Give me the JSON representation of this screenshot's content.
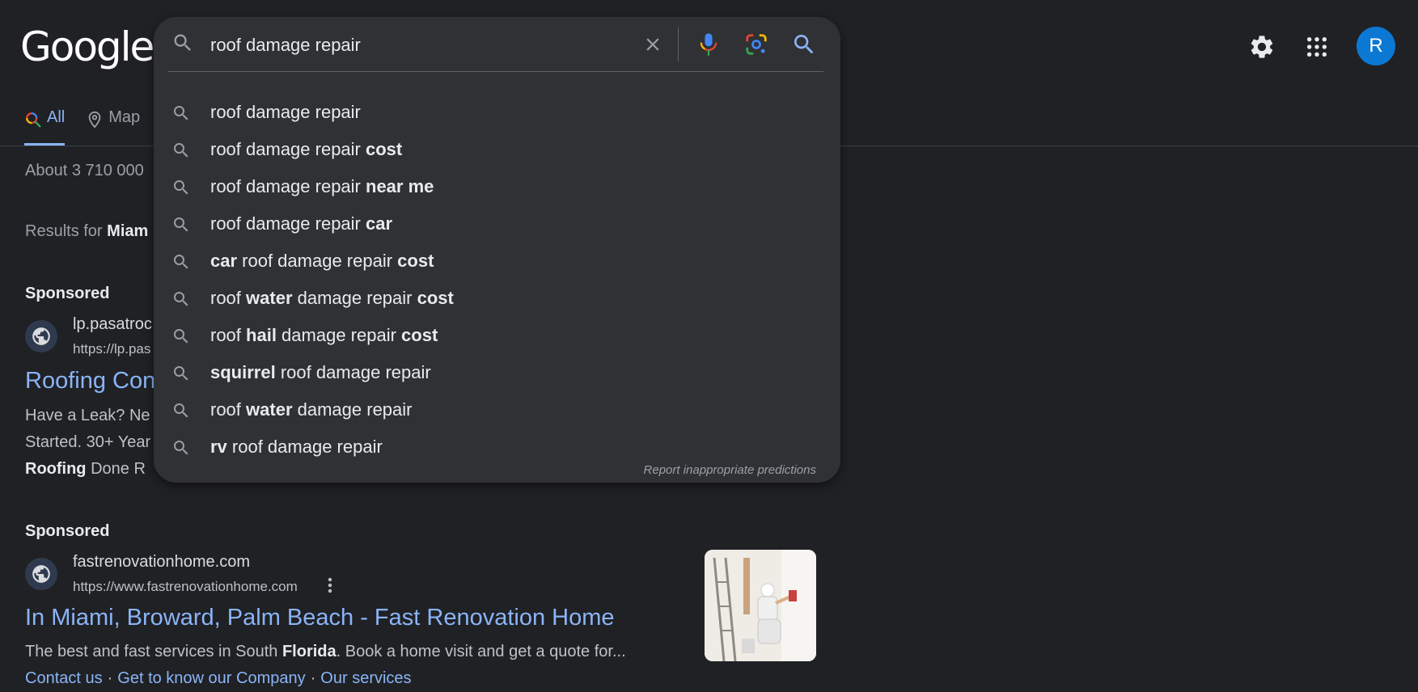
{
  "header": {
    "logo_text": "Google",
    "avatar_letter": "R"
  },
  "search": {
    "query": "roof damage repair",
    "report_label": "Report inappropriate predictions",
    "suggestions": [
      {
        "segments": [
          {
            "t": "roof damage repair",
            "b": false
          }
        ]
      },
      {
        "segments": [
          {
            "t": "roof damage repair ",
            "b": false
          },
          {
            "t": "cost",
            "b": true
          }
        ]
      },
      {
        "segments": [
          {
            "t": "roof damage repair ",
            "b": false
          },
          {
            "t": "near me",
            "b": true
          }
        ]
      },
      {
        "segments": [
          {
            "t": "roof damage repair ",
            "b": false
          },
          {
            "t": "car",
            "b": true
          }
        ]
      },
      {
        "segments": [
          {
            "t": "car",
            "b": true
          },
          {
            "t": " roof damage repair ",
            "b": false
          },
          {
            "t": "cost",
            "b": true
          }
        ]
      },
      {
        "segments": [
          {
            "t": "roof ",
            "b": false
          },
          {
            "t": "water",
            "b": true
          },
          {
            "t": " damage repair ",
            "b": false
          },
          {
            "t": "cost",
            "b": true
          }
        ]
      },
      {
        "segments": [
          {
            "t": "roof ",
            "b": false
          },
          {
            "t": "hail",
            "b": true
          },
          {
            "t": " damage repair ",
            "b": false
          },
          {
            "t": "cost",
            "b": true
          }
        ]
      },
      {
        "segments": [
          {
            "t": "squirrel",
            "b": true
          },
          {
            "t": " roof damage repair",
            "b": false
          }
        ]
      },
      {
        "segments": [
          {
            "t": "roof ",
            "b": false
          },
          {
            "t": "water",
            "b": true
          },
          {
            "t": " damage repair",
            "b": false
          }
        ]
      },
      {
        "segments": [
          {
            "t": "rv",
            "b": true
          },
          {
            "t": " roof damage repair",
            "b": false
          }
        ]
      }
    ]
  },
  "tabs": [
    {
      "label": "All",
      "active": true
    },
    {
      "label": "Map",
      "active": false
    }
  ],
  "result_stats": "About 3 710 000",
  "results_for": {
    "prefix": "Results for ",
    "location": "Miam"
  },
  "ads": [
    {
      "sponsored_label": "Sponsored",
      "site_name": "lp.pasatroc",
      "site_url": "https://lp.pas",
      "title": "Roofing Con",
      "desc_line1": "Have a Leak? Ne",
      "desc_line2": "Started. 30+ Year",
      "desc_line3_bold": "Roofing",
      "desc_line3_rest": " Done R"
    },
    {
      "sponsored_label": "Sponsored",
      "site_name": "fastrenovationhome.com",
      "site_url": "https://www.fastrenovationhome.com",
      "title": "In Miami, Broward, Palm Beach - Fast Renovation Home",
      "desc_pre": "The best and fast services in South ",
      "desc_bold": "Florida",
      "desc_post": ". Book a home visit and get a quote for...",
      "sitelinks": [
        "Contact us",
        "Get to know our Company",
        "Our services"
      ]
    }
  ],
  "colors": {
    "background": "#202124",
    "dropdown": "#303134",
    "link": "#8ab4f8",
    "avatar": "#0b78d3"
  },
  "icons": [
    "search-icon",
    "close-icon",
    "mic-icon",
    "lens-icon",
    "gear-icon",
    "apps-grid-icon",
    "globe-icon",
    "map-pin-icon",
    "more-vert-icon"
  ]
}
